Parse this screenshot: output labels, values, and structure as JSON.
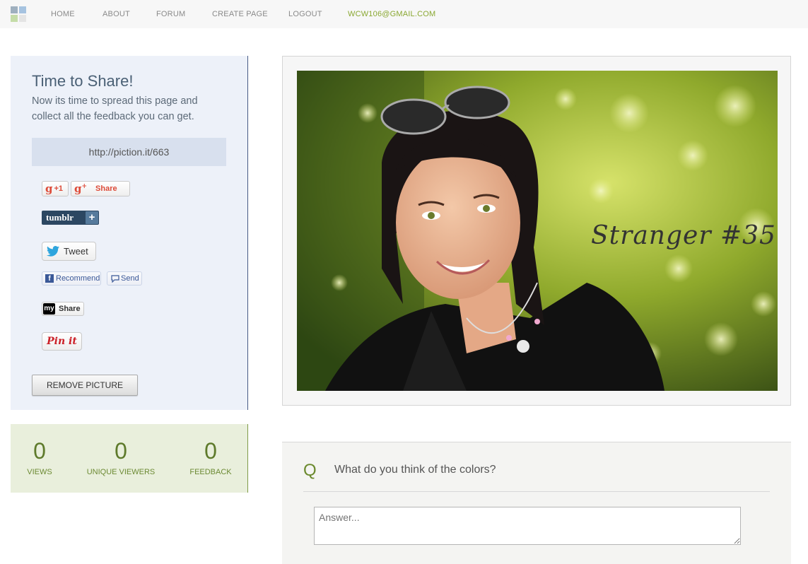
{
  "nav": {
    "items": [
      "HOME",
      "ABOUT",
      "FORUM",
      "CREATE PAGE",
      "LOGOUT"
    ],
    "email": "WCW106@GMAIL.COM"
  },
  "colors": {
    "logo": [
      "#b8c4cf",
      "#a6c3e0",
      "#c5dca8",
      "#e8e8e8"
    ],
    "accent_green": "#8aa832",
    "panel_blue": "#edf1f9",
    "panel_green": "#e9efdc"
  },
  "share": {
    "title": "Time to Share!",
    "description": "Now its time to spread this page and collect all the feedback you can get.",
    "url": "http://piction.it/663",
    "gplus_one": "+1",
    "gplus_share": "Share",
    "tumblr": "tumblr",
    "tweet": "Tweet",
    "recommend": "Recommend",
    "send": "Send",
    "myspace_share": "Share",
    "pinit": "Pin it",
    "remove_button": "REMOVE PICTURE"
  },
  "stats": [
    {
      "value": "0",
      "label": "VIEWS"
    },
    {
      "value": "0",
      "label": "UNIQUE VIEWERS"
    },
    {
      "value": "0",
      "label": "FEEDBACK"
    }
  ],
  "photo": {
    "caption": "Stranger #35"
  },
  "question": {
    "marker": "Q",
    "text": "What do you think of the colors?",
    "answer_placeholder": "Answer..."
  }
}
